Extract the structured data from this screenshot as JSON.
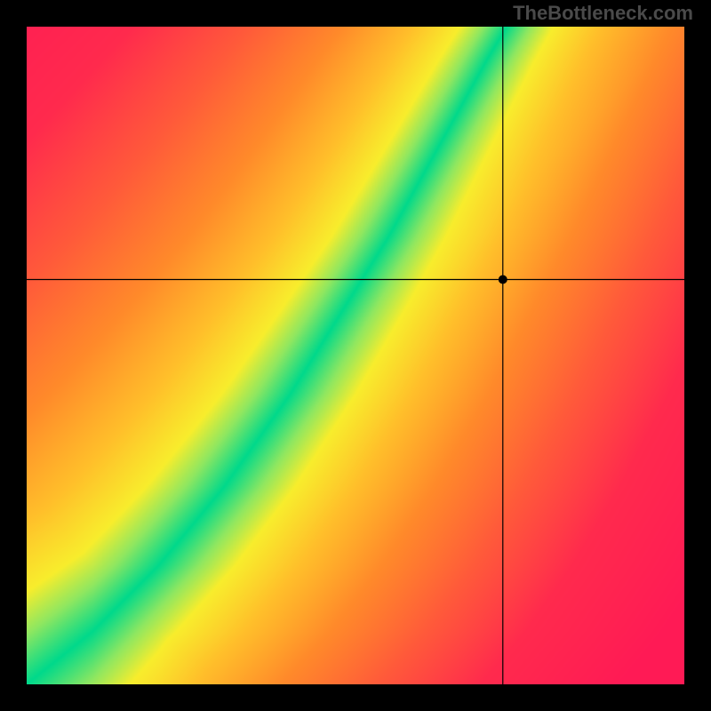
{
  "watermark": "TheBottleneck.com",
  "chart_data": {
    "type": "heatmap",
    "title": "",
    "xlabel": "",
    "ylabel": "",
    "xlim": [
      0,
      1
    ],
    "ylim": [
      0,
      1
    ],
    "grid": false,
    "legend": false,
    "marker": {
      "x": 0.725,
      "y": 0.615,
      "radius": 5
    },
    "crosshair": {
      "x": 0.725,
      "y": 0.615
    },
    "optimal_curve": {
      "description": "Green optimal band center: y as a function of x (normalized 0-1). Band follows a superlinear curve from origin, steepening through the middle.",
      "points": [
        {
          "x": 0.0,
          "y": 0.0
        },
        {
          "x": 0.05,
          "y": 0.04
        },
        {
          "x": 0.1,
          "y": 0.08
        },
        {
          "x": 0.15,
          "y": 0.13
        },
        {
          "x": 0.2,
          "y": 0.18
        },
        {
          "x": 0.25,
          "y": 0.24
        },
        {
          "x": 0.3,
          "y": 0.3
        },
        {
          "x": 0.35,
          "y": 0.37
        },
        {
          "x": 0.4,
          "y": 0.44
        },
        {
          "x": 0.45,
          "y": 0.52
        },
        {
          "x": 0.5,
          "y": 0.6
        },
        {
          "x": 0.55,
          "y": 0.68
        },
        {
          "x": 0.6,
          "y": 0.77
        },
        {
          "x": 0.65,
          "y": 0.86
        },
        {
          "x": 0.7,
          "y": 0.95
        },
        {
          "x": 0.73,
          "y": 1.0
        }
      ]
    },
    "band_half_width_normalized": 0.035,
    "color_scale": {
      "description": "Distance from optimal curve mapped to color",
      "stops": [
        {
          "d": 0.0,
          "color": "#00d98b"
        },
        {
          "d": 0.05,
          "color": "#8fe760"
        },
        {
          "d": 0.1,
          "color": "#f8ed2c"
        },
        {
          "d": 0.2,
          "color": "#ffbf2a"
        },
        {
          "d": 0.35,
          "color": "#ff8a2a"
        },
        {
          "d": 0.55,
          "color": "#ff5a3a"
        },
        {
          "d": 0.8,
          "color": "#ff2a4d"
        },
        {
          "d": 1.2,
          "color": "#ff1a55"
        }
      ]
    }
  }
}
